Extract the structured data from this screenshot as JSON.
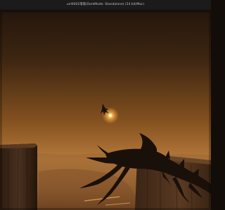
{
  "window": {
    "title": "unl0001環境(DarkMode: Standalone) (24 bit/Mac)"
  },
  "scene": {
    "description_icons": [
      "sun-glow",
      "flying-creature",
      "rock-pillar-left",
      "rock-pillar-right",
      "clawed-creature"
    ],
    "colors": {
      "sky_top": "#2a1a0e",
      "sky_mid": "#6a3f1c",
      "sky_horizon": "#c98a4a",
      "ground_haze": "#a8703c",
      "silhouette": "#1a100a",
      "sun": "#ffcf6a"
    }
  }
}
